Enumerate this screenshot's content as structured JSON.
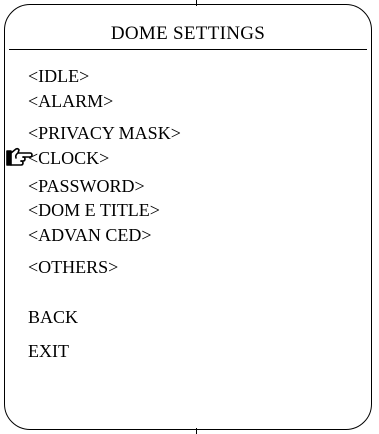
{
  "title": "DOME SETTINGS",
  "menu_items": [
    "<IDLE>",
    "<ALARM>",
    "<PRIVACY MASK>",
    "<CLOCK>",
    "<PASSWORD>",
    "<DOM E TITLE>",
    "<ADVAN CED>",
    "<OTHERS>"
  ],
  "selected_item": "<CLOCK>",
  "pointer_icon": "pointing-hand-icon",
  "actions": {
    "back": "BACK",
    "exit": "EXIT"
  }
}
